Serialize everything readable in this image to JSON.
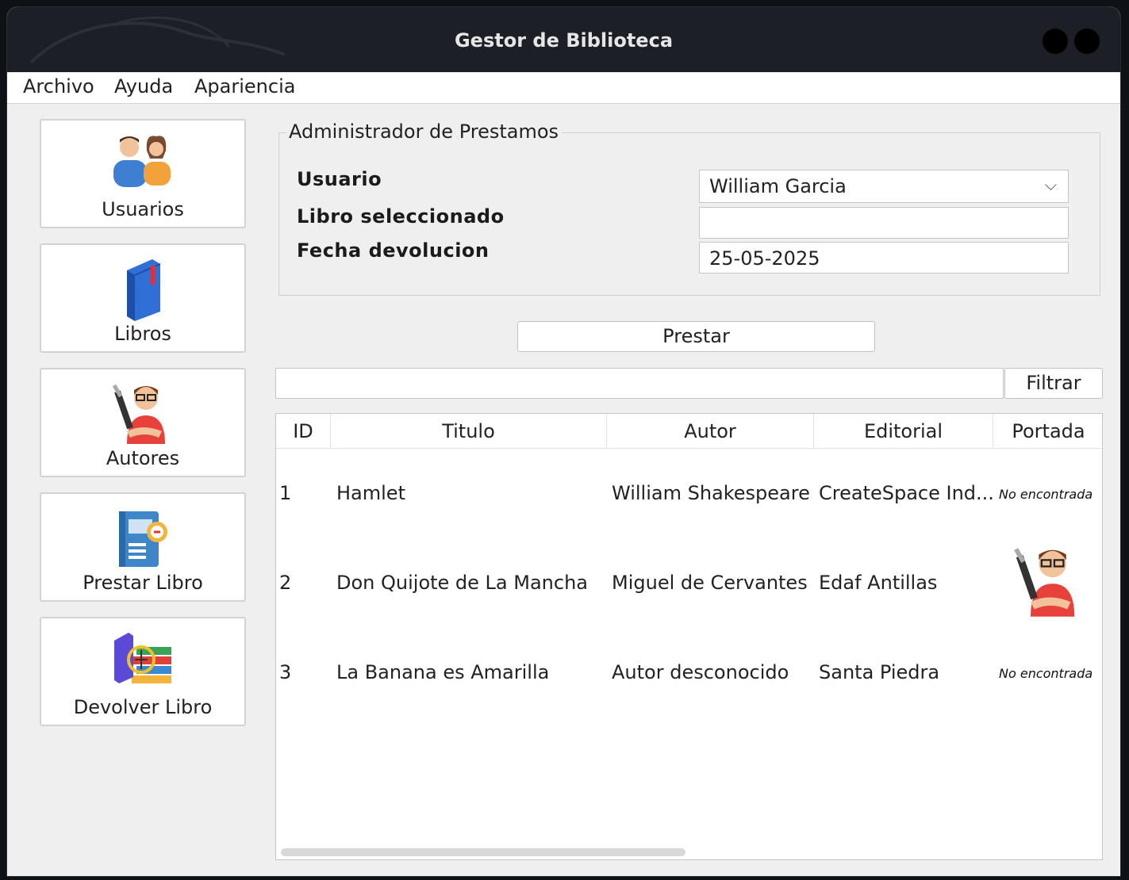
{
  "window": {
    "title": "Gestor de Biblioteca"
  },
  "menu": [
    "Archivo",
    "Ayuda",
    "Apariencia"
  ],
  "sidebar": {
    "items": [
      {
        "label": "Usuarios",
        "icon": "users-icon"
      },
      {
        "label": "Libros",
        "icon": "book-icon"
      },
      {
        "label": "Autores",
        "icon": "author-icon"
      },
      {
        "label": "Prestar Libro",
        "icon": "lend-book-icon"
      },
      {
        "label": "Devolver Libro",
        "icon": "return-book-icon"
      }
    ]
  },
  "loan": {
    "legend": "Administrador de Prestamos",
    "user_label": "Usuario",
    "user_value": "William Garcia",
    "book_label": "Libro seleccionado",
    "book_value": "",
    "date_label": "Fecha devolucion",
    "date_value": "25-05-2025",
    "lend_button": "Prestar"
  },
  "filter": {
    "value": "",
    "button": "Filtrar"
  },
  "table": {
    "columns": [
      "ID",
      "Titulo",
      "Autor",
      "Editorial",
      "Portada"
    ],
    "rows": [
      {
        "id": "1",
        "title": "Hamlet",
        "author": "William Shakespeare",
        "publisher": "CreateSpace Ind...",
        "cover": "No encontrada"
      },
      {
        "id": "2",
        "title": "Don Quijote de La Mancha",
        "author": "Miguel de Cervantes",
        "publisher": "Edaf Antillas",
        "cover": "author-image"
      },
      {
        "id": "3",
        "title": "La Banana es Amarilla",
        "author": "Autor desconocido",
        "publisher": "Santa Piedra",
        "cover": "No encontrada"
      }
    ]
  }
}
